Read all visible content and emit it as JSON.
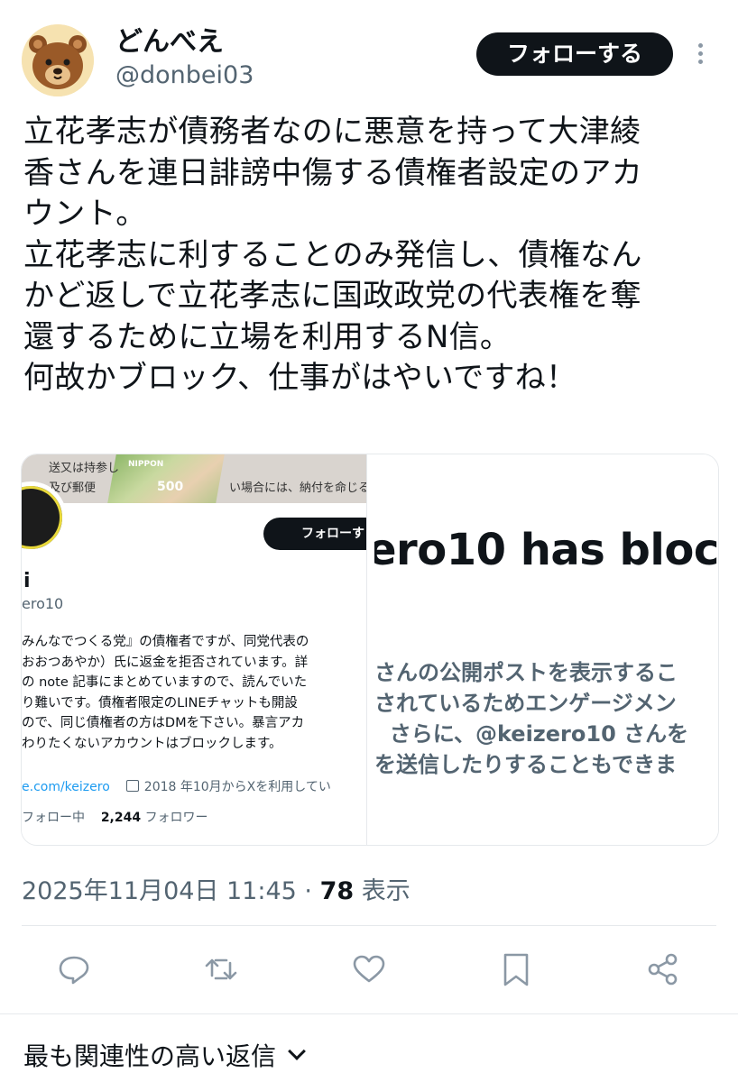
{
  "post": {
    "display_name": "どんべえ",
    "handle": "@donbei03",
    "follow_label": "フォローする",
    "text": "立花孝志が債務者なのに悪意を持って大津綾\n香さんを連日誹謗中傷する債権者設定のアカ\nウント。\n立花孝志に利することのみ発信し、債権なん\nかど返しで立花孝志に国政政党の代表権を奪\n還するために立場を利用するN信。\n何故かブロック、仕事がはやいですね！",
    "timestamp": "2025年11月04日 11:45",
    "separator": "·",
    "views": "78",
    "views_label": "表示"
  },
  "media_left": {
    "banner_text1": "送又は持参し",
    "banner_text2": "及び郵便",
    "banner_text3": "い場合には、納付を命じる補正命",
    "stamp_label": "NIPPON",
    "stamp_value": "500",
    "follow_label": "フォローす",
    "name_fragment": "i",
    "handle": "ero10",
    "bio": "みんなでつくる党』の債権者ですが、同党代表の\nおおつあやか）氏に返金を拒否されています。詳\nの note 記事にまとめていますので、読んでいた\nり難いです。債権者限定のLINEチャットも開設\nので、同じ債権者の方はDMを下さい。暴言アカ\nわりたくないアカウントはブロックします。",
    "link": "e.com/keizero",
    "joined": "2018 年10月からXを利用してい",
    "following_label": "フォロー中",
    "followers_count": "2,244",
    "followers_label": "フォロワー"
  },
  "media_right": {
    "title": "ero10 has bloc",
    "message": "さんの公開ポストを表示するこ\nされているためエンゲージメン\n  さらに、@keizero10 さんを\nを送信したりすることもできま"
  },
  "actions": {
    "icons": [
      "reply-icon",
      "repost-icon",
      "like-icon",
      "bookmark-icon",
      "share-icon"
    ]
  },
  "replies": {
    "sort_label": "最も関連性の高い返信"
  },
  "colors": {
    "text": "#0f1419",
    "secondary": "#536471",
    "link": "#1d9bf0",
    "button_bg": "#0f1419"
  }
}
